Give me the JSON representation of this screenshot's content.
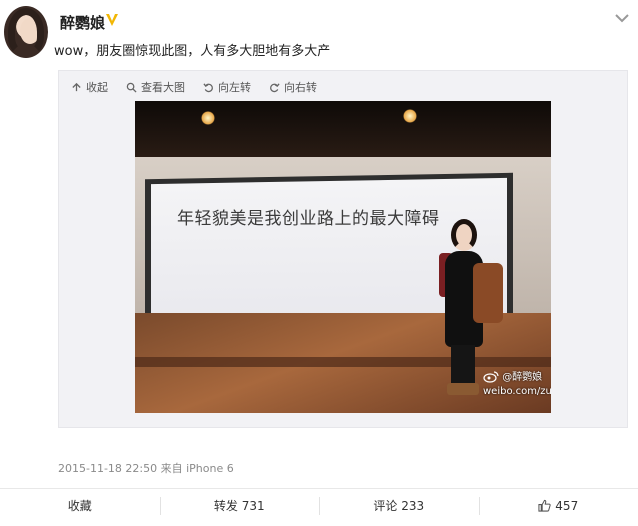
{
  "post": {
    "username": "醉鹦娘",
    "text": "wow，朋友圈惊现此图，人有多大胆地有多大产",
    "timestamp": "2015-11-18 22:50",
    "source": "来自 iPhone 6"
  },
  "toolbar": {
    "collapse": "收起",
    "view_large": "查看大图",
    "rotate_left": "向左转",
    "rotate_right": "向右转"
  },
  "photo": {
    "screen_text": "年轻貌美是我创业路上的最大障碍",
    "watermark_name": "@醉鹦娘",
    "watermark_url": "weibo.com/zuieniang"
  },
  "actions": {
    "favorite": "收藏",
    "repost": "转发 731",
    "comment": "评论 233",
    "like": "457"
  },
  "colors": {
    "vip_badge": "#f2b705",
    "text_primary": "#222222",
    "text_muted": "#8a8a8a"
  }
}
